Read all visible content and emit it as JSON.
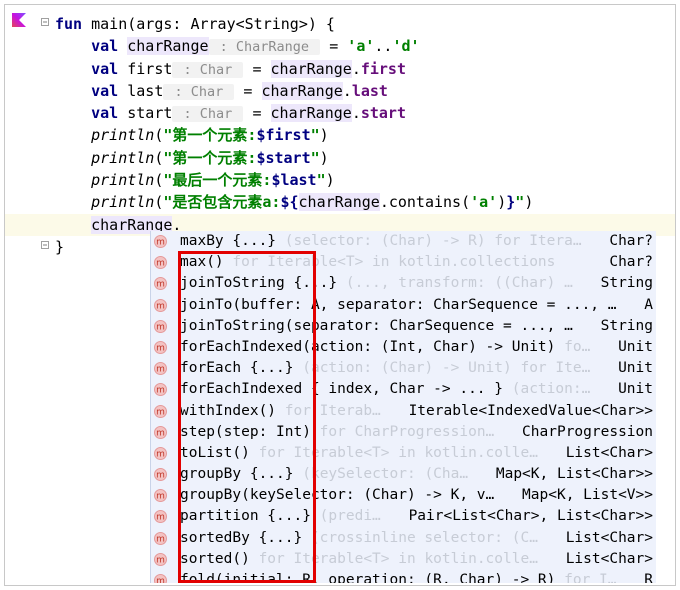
{
  "editor": {
    "lines": [
      {
        "id": "l1",
        "parts": [
          [
            "kw",
            "fun"
          ],
          [
            "plain",
            " main(args: Array<String>) {"
          ]
        ]
      },
      {
        "id": "l2",
        "parts": [
          [
            "plain",
            "    "
          ],
          [
            "kw",
            "val"
          ],
          [
            "plain",
            " "
          ],
          [
            "var",
            "charRange"
          ],
          [
            "hint",
            " : CharRange "
          ],
          [
            "plain",
            " = "
          ],
          [
            "str",
            "'a'"
          ],
          [
            "plain",
            ".."
          ],
          [
            "str",
            "'d'"
          ]
        ]
      },
      {
        "id": "l3",
        "parts": [
          [
            "plain",
            "    "
          ],
          [
            "kw",
            "val"
          ],
          [
            "plain",
            " first"
          ],
          [
            "hint",
            " : Char "
          ],
          [
            "plain",
            " = "
          ],
          [
            "var",
            "charRange"
          ],
          [
            "plain",
            "."
          ],
          [
            "prop",
            "first"
          ]
        ]
      },
      {
        "id": "l4",
        "parts": [
          [
            "plain",
            "    "
          ],
          [
            "kw",
            "val"
          ],
          [
            "plain",
            " last"
          ],
          [
            "hint",
            " : Char "
          ],
          [
            "plain",
            " = "
          ],
          [
            "var",
            "charRange"
          ],
          [
            "plain",
            "."
          ],
          [
            "prop",
            "last"
          ]
        ]
      },
      {
        "id": "l5",
        "parts": [
          [
            "plain",
            "    "
          ],
          [
            "kw",
            "val"
          ],
          [
            "plain",
            " start"
          ],
          [
            "hint",
            " : Char "
          ],
          [
            "plain",
            " = "
          ],
          [
            "var",
            "charRange"
          ],
          [
            "plain",
            "."
          ],
          [
            "prop",
            "start"
          ]
        ]
      },
      {
        "id": "l6",
        "parts": [
          [
            "plain",
            "    "
          ],
          [
            "italic",
            "println"
          ],
          [
            "plain",
            "("
          ],
          [
            "str",
            "\"第一个元素:"
          ],
          [
            "tmpl",
            "$first"
          ],
          [
            "str",
            "\""
          ],
          [
            "plain",
            ")"
          ]
        ]
      },
      {
        "id": "l7",
        "parts": [
          [
            "plain",
            "    "
          ],
          [
            "italic",
            "println"
          ],
          [
            "plain",
            "("
          ],
          [
            "str",
            "\"第一个元素:"
          ],
          [
            "tmpl",
            "$start"
          ],
          [
            "str",
            "\""
          ],
          [
            "plain",
            ")"
          ]
        ]
      },
      {
        "id": "l8",
        "parts": [
          [
            "plain",
            "    "
          ],
          [
            "italic",
            "println"
          ],
          [
            "plain",
            "("
          ],
          [
            "str",
            "\"最后一个元素:"
          ],
          [
            "tmpl",
            "$last"
          ],
          [
            "str",
            "\""
          ],
          [
            "plain",
            ")"
          ]
        ]
      },
      {
        "id": "l9",
        "parts": [
          [
            "plain",
            "    "
          ],
          [
            "italic",
            "println"
          ],
          [
            "plain",
            "("
          ],
          [
            "str",
            "\"是否包含元素a:"
          ],
          [
            "tmpl",
            "${"
          ],
          [
            "var",
            "charRange"
          ],
          [
            "plain",
            ".contains("
          ],
          [
            "str",
            "'a'"
          ],
          [
            "plain",
            ")"
          ],
          [
            "tmpl",
            "}"
          ],
          [
            "str",
            "\""
          ],
          [
            "plain",
            ")"
          ]
        ]
      },
      {
        "id": "l10",
        "current": true,
        "parts": [
          [
            "plain",
            "    "
          ],
          [
            "var",
            "charRange"
          ],
          [
            "plain",
            "."
          ]
        ]
      },
      {
        "id": "l11",
        "parts": [
          [
            "plain",
            "}"
          ]
        ]
      }
    ]
  },
  "completion": {
    "items": [
      {
        "name": "maxBy {...}",
        "tail": " (selector: (Char) -> R) for Itera…",
        "type": "Char?"
      },
      {
        "name": "max()",
        "tail": " for Iterable<T> in kotlin.collections",
        "type": "Char?"
      },
      {
        "name": "joinToString {...}",
        "tail": " (..., transform: ((Char) …",
        "type": "String"
      },
      {
        "name": "joinTo(buffer: A, separator: CharSequence = ..., …",
        "tail": "",
        "type": "A"
      },
      {
        "name": "joinToString(separator: CharSequence = ..., …",
        "tail": "",
        "type": "String"
      },
      {
        "name": "forEachIndexed(action: (Int, Char) -> Unit)",
        "tail": " fo…",
        "type": "Unit"
      },
      {
        "name": "forEach {...}",
        "tail": " (action: (Char) -> Unit) for Ite…",
        "type": "Unit"
      },
      {
        "name": "forEachIndexed { index, Char -> ... }",
        "tail": " (action:…",
        "type": "Unit"
      },
      {
        "name": "withIndex()",
        "tail": " for Iterab…",
        "type": "Iterable<IndexedValue<Char>>"
      },
      {
        "name": "step(step: Int)",
        "tail": " for CharProgression…",
        "type": "CharProgression"
      },
      {
        "name": "toList()",
        "tail": " for Iterable<T> in kotlin.colle…",
        "type": "List<Char>"
      },
      {
        "name": "groupBy {...}",
        "tail": " (keySelector: (Cha…",
        "type": "Map<K, List<Char>>"
      },
      {
        "name": "groupBy(keySelector: (Char) -> K, v…",
        "tail": "",
        "type": "Map<K, List<V>>"
      },
      {
        "name": "partition {...}",
        "tail": " (predi…",
        "type": "Pair<List<Char>, List<Char>>"
      },
      {
        "name": "sortedBy {...}",
        "tail": " (crossinline selector: (C…",
        "type": "List<Char>"
      },
      {
        "name": "sorted()",
        "tail": " for Iterable<T> in kotlin.colle…",
        "type": "List<Char>"
      },
      {
        "name": "fold(initial: R, operation: (R, Char) -> R)",
        "tail": " for I…",
        "type": "R"
      }
    ],
    "icon": "extension-function-icon"
  },
  "colors": {
    "highlight_box": "#e20000",
    "popup_bg": "#eef2fc",
    "current_line": "#fcfae8"
  }
}
